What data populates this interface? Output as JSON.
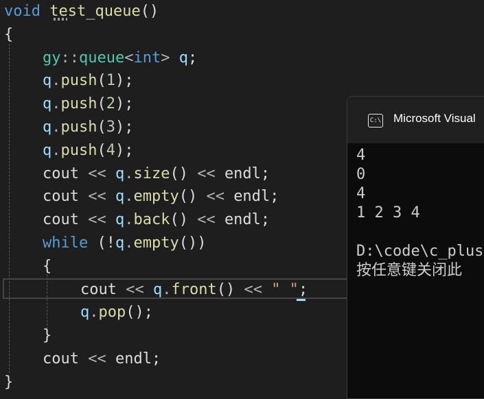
{
  "editor": {
    "lines": [
      {
        "tokens": [
          {
            "t": "void",
            "c": "kw"
          },
          {
            "t": " ",
            "c": "txt"
          },
          {
            "t": "test_queue",
            "c": "fn"
          },
          {
            "t": "()",
            "c": "txt"
          }
        ]
      },
      {
        "tokens": [
          {
            "t": "{",
            "c": "txt"
          }
        ]
      },
      {
        "tokens": [
          {
            "t": "gy",
            "c": "ty"
          },
          {
            "t": "::",
            "c": "op"
          },
          {
            "t": "queue",
            "c": "ty"
          },
          {
            "t": "<",
            "c": "op"
          },
          {
            "t": "int",
            "c": "kw"
          },
          {
            "t": ">",
            "c": "op"
          },
          {
            "t": " ",
            "c": "txt"
          },
          {
            "t": "q",
            "c": "var"
          },
          {
            "t": ";",
            "c": "txt"
          }
        ]
      },
      {
        "tokens": [
          {
            "t": "q",
            "c": "var"
          },
          {
            "t": ".",
            "c": "op"
          },
          {
            "t": "push",
            "c": "fn"
          },
          {
            "t": "(",
            "c": "txt"
          },
          {
            "t": "1",
            "c": "num"
          },
          {
            "t": ");",
            "c": "txt"
          }
        ]
      },
      {
        "tokens": [
          {
            "t": "q",
            "c": "var"
          },
          {
            "t": ".",
            "c": "op"
          },
          {
            "t": "push",
            "c": "fn"
          },
          {
            "t": "(",
            "c": "txt"
          },
          {
            "t": "2",
            "c": "num"
          },
          {
            "t": ");",
            "c": "txt"
          }
        ]
      },
      {
        "tokens": [
          {
            "t": "q",
            "c": "var"
          },
          {
            "t": ".",
            "c": "op"
          },
          {
            "t": "push",
            "c": "fn"
          },
          {
            "t": "(",
            "c": "txt"
          },
          {
            "t": "3",
            "c": "num"
          },
          {
            "t": ");",
            "c": "txt"
          }
        ]
      },
      {
        "tokens": [
          {
            "t": "q",
            "c": "var"
          },
          {
            "t": ".",
            "c": "op"
          },
          {
            "t": "push",
            "c": "fn"
          },
          {
            "t": "(",
            "c": "txt"
          },
          {
            "t": "4",
            "c": "num"
          },
          {
            "t": ");",
            "c": "txt"
          }
        ]
      },
      {
        "tokens": [
          {
            "t": "cout",
            "c": "txt"
          },
          {
            "t": " << ",
            "c": "op"
          },
          {
            "t": "q",
            "c": "var"
          },
          {
            "t": ".",
            "c": "op"
          },
          {
            "t": "size",
            "c": "fn"
          },
          {
            "t": "()",
            "c": "txt"
          },
          {
            "t": " << ",
            "c": "op"
          },
          {
            "t": "endl",
            "c": "txt"
          },
          {
            "t": ";",
            "c": "txt"
          }
        ]
      },
      {
        "tokens": [
          {
            "t": "cout",
            "c": "txt"
          },
          {
            "t": " << ",
            "c": "op"
          },
          {
            "t": "q",
            "c": "var"
          },
          {
            "t": ".",
            "c": "op"
          },
          {
            "t": "empty",
            "c": "fn"
          },
          {
            "t": "()",
            "c": "txt"
          },
          {
            "t": " << ",
            "c": "op"
          },
          {
            "t": "endl",
            "c": "txt"
          },
          {
            "t": ";",
            "c": "txt"
          }
        ]
      },
      {
        "tokens": [
          {
            "t": "cout",
            "c": "txt"
          },
          {
            "t": " << ",
            "c": "op"
          },
          {
            "t": "q",
            "c": "var"
          },
          {
            "t": ".",
            "c": "op"
          },
          {
            "t": "back",
            "c": "fn"
          },
          {
            "t": "()",
            "c": "txt"
          },
          {
            "t": " << ",
            "c": "op"
          },
          {
            "t": "endl",
            "c": "txt"
          },
          {
            "t": ";",
            "c": "txt"
          }
        ]
      },
      {
        "tokens": [
          {
            "t": "while",
            "c": "kw"
          },
          {
            "t": " (!",
            "c": "txt"
          },
          {
            "t": "q",
            "c": "var"
          },
          {
            "t": ".",
            "c": "op"
          },
          {
            "t": "empty",
            "c": "fn"
          },
          {
            "t": "())",
            "c": "txt"
          }
        ]
      },
      {
        "tokens": [
          {
            "t": "{",
            "c": "txt"
          }
        ]
      },
      {
        "tokens": [
          {
            "t": "cout",
            "c": "txt"
          },
          {
            "t": " << ",
            "c": "op"
          },
          {
            "t": "q",
            "c": "var"
          },
          {
            "t": ".",
            "c": "op"
          },
          {
            "t": "front",
            "c": "fn"
          },
          {
            "t": "()",
            "c": "txt"
          },
          {
            "t": " << ",
            "c": "op"
          },
          {
            "t": "\" \"",
            "c": "str"
          },
          {
            "t": ";",
            "c": "txt"
          }
        ]
      },
      {
        "tokens": [
          {
            "t": "q",
            "c": "var"
          },
          {
            "t": ".",
            "c": "op"
          },
          {
            "t": "pop",
            "c": "fn"
          },
          {
            "t": "();",
            "c": "txt"
          }
        ]
      },
      {
        "tokens": [
          {
            "t": "}",
            "c": "txt"
          }
        ]
      },
      {
        "tokens": [
          {
            "t": "cout",
            "c": "txt"
          },
          {
            "t": " << ",
            "c": "op"
          },
          {
            "t": "endl",
            "c": "txt"
          },
          {
            "t": ";",
            "c": "txt"
          }
        ]
      },
      {
        "tokens": [
          {
            "t": "}",
            "c": "txt"
          }
        ]
      }
    ]
  },
  "console": {
    "title": "Microsoft Visual",
    "icon": "terminal-icon",
    "icon_glyph": "C:\\",
    "lines": [
      "4",
      "0",
      "4",
      "1 2 3 4",
      "",
      "D:\\code\\c_plus",
      "按任意键关闭此"
    ]
  },
  "colors": {
    "background": "#1e1e1e",
    "keyword": "#569cd6",
    "function": "#dcdcaa",
    "type": "#4ec9b0",
    "variable": "#9cdcfe",
    "console_bg": "#0c0c0c"
  }
}
